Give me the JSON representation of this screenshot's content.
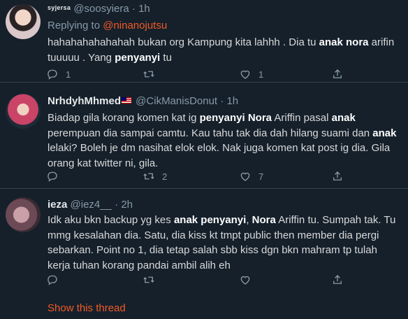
{
  "tweets": [
    {
      "small_name": "syjersa",
      "handle": "@soosyiera",
      "time": "1h",
      "reply_prefix": "Replying to ",
      "reply_to": "@ninanojutsu",
      "body_segments": [
        {
          "text": "hahahahahahahah bukan org Kampung kita lahhh . Dia tu "
        },
        {
          "text": "anak nora",
          "bold": true
        },
        {
          "text": " arifin tuuuuu . Yang "
        },
        {
          "text": "penyanyi",
          "bold": true
        },
        {
          "text": " tu"
        }
      ],
      "replies": "1",
      "retweets": "",
      "likes": "1"
    },
    {
      "name": "NrhdyhMhmed",
      "flag": "malaysia-flag",
      "handle": "@CikManisDonut",
      "time": "1h",
      "body_segments": [
        {
          "text": "Biadap gila korang komen kat ig "
        },
        {
          "text": "penyanyi Nora",
          "bold": true
        },
        {
          "text": " Ariffin pasal "
        },
        {
          "text": "anak",
          "bold": true
        },
        {
          "text": " perempuan dia sampai camtu. Kau tahu tak dia dah hilang suami dan "
        },
        {
          "text": "anak",
          "bold": true
        },
        {
          "text": " lelaki? Boleh je dm nasihat elok elok. Nak juga komen kat post ig dia. Gila orang kat twitter ni, gila."
        }
      ],
      "replies": "",
      "retweets": "2",
      "likes": "7"
    },
    {
      "name": "ieza",
      "handle": "@iez4__",
      "time": "2h",
      "body_segments": [
        {
          "text": "Idk aku bkn backup yg kes "
        },
        {
          "text": "anak penyanyi",
          "bold": true
        },
        {
          "text": ", "
        },
        {
          "text": "Nora",
          "bold": true
        },
        {
          "text": " Ariffin tu. Sumpah tak. Tu mmg kesalahan dia. Satu, dia kiss kt tmpt public then member dia pergi sebarkan. Point no 1, dia tetap salah sbb kiss dgn bkn mahram tp tulah kerja tuhan korang pandai ambil alih eh"
        }
      ],
      "replies": "",
      "retweets": "",
      "likes": ""
    }
  ],
  "show_thread": "Show this thread",
  "colors": {
    "background": "#15202b",
    "accent": "#f15a26",
    "muted": "#8899a6",
    "divider": "#38444d"
  }
}
